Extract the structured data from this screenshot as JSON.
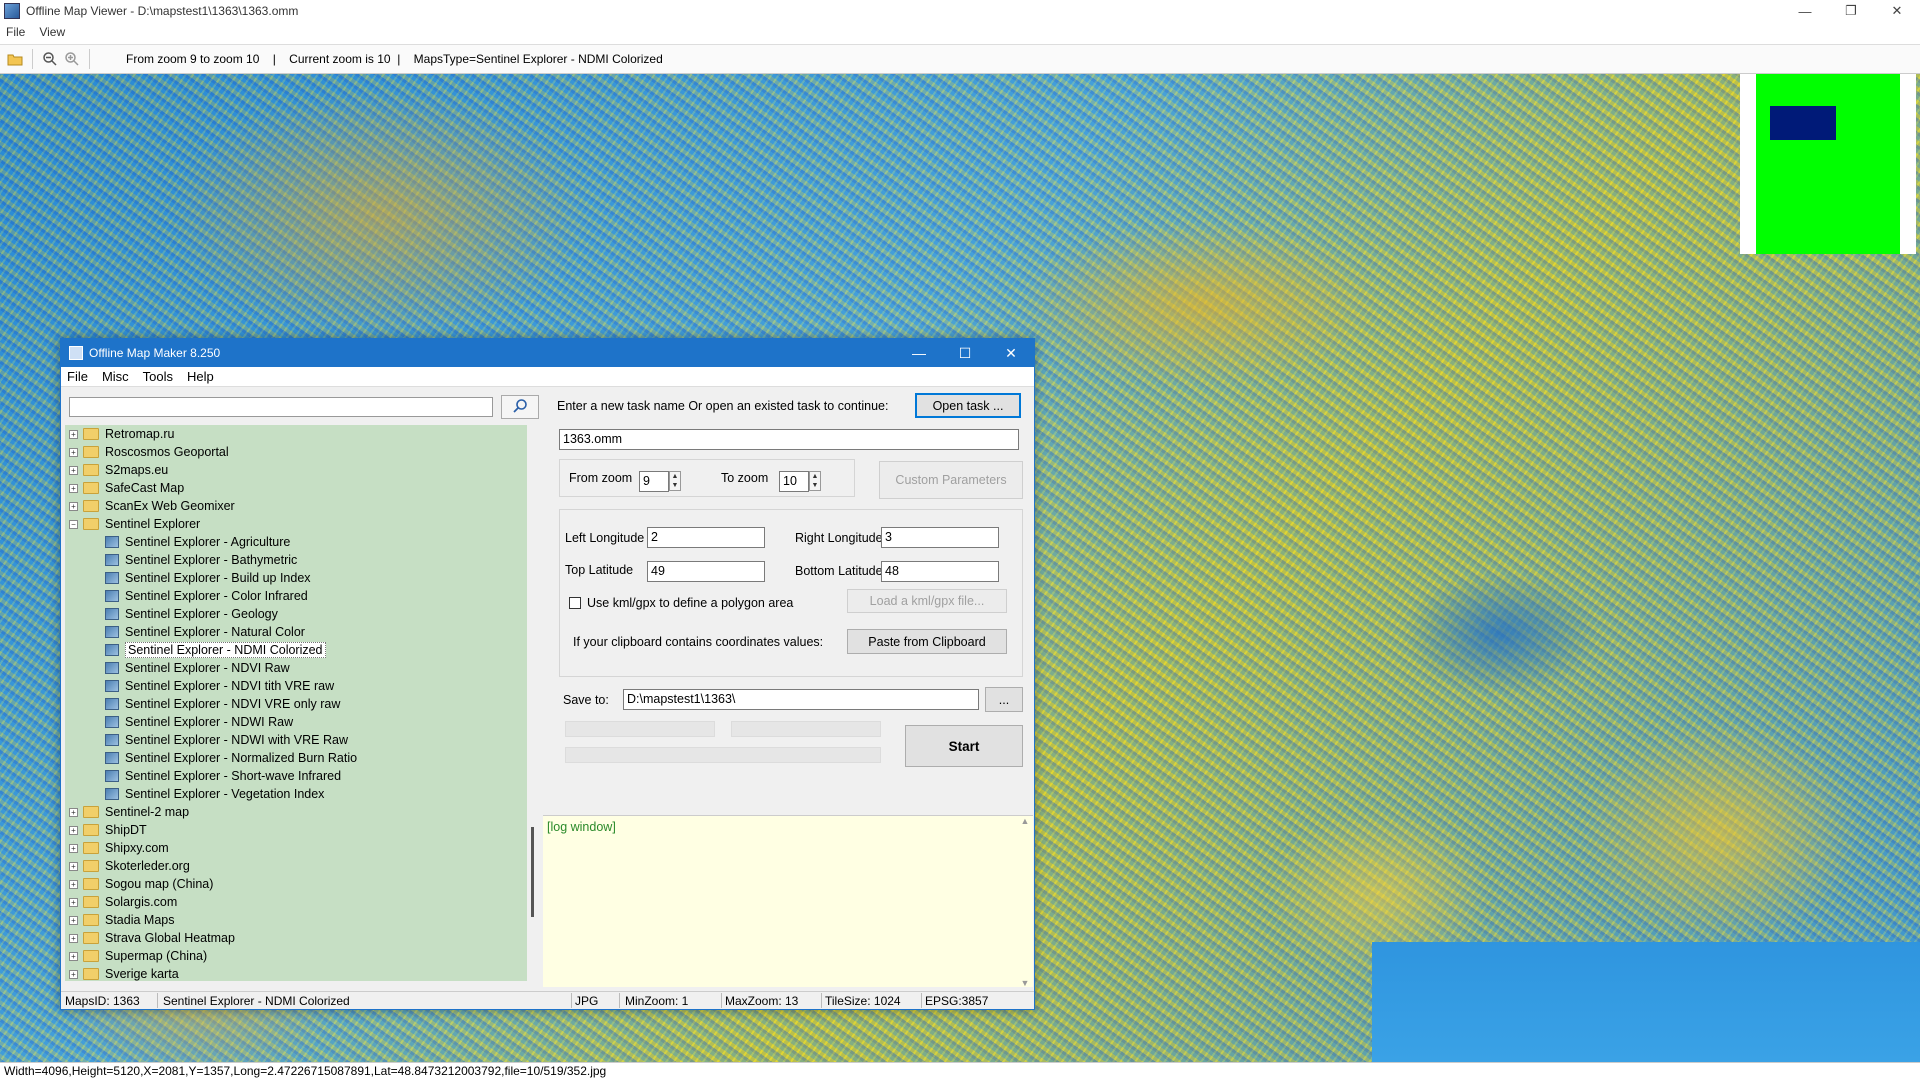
{
  "window": {
    "title": "Offline Map Viewer - D:\\mapstest1\\1363\\1363.omm",
    "controls": [
      "—",
      "❐",
      "✕"
    ]
  },
  "menu": [
    "File",
    "View"
  ],
  "toolbar": {
    "icons": [
      "folder-open-icon",
      "zoom-out-icon",
      "zoom-in-icon"
    ],
    "info": "From zoom 9 to zoom 10    |    Current zoom is 10  |    MapsType=Sentinel Explorer - NDMI Colorized"
  },
  "colors": {
    "minimap_area": "#00ff00",
    "minimap_view": "#001a78",
    "dialog_title": "#1e73c9",
    "tree_bg": "#c6dfc4",
    "log_bg": "#ffffe3"
  },
  "status": "Width=4096,Height=5120,X=2081,Y=1357,Long=2.47226715087891,Lat=48.8473212003792,file=10/519/352.jpg",
  "dialog": {
    "title": "Offline Map Maker 8.250",
    "controls": [
      "—",
      "☐",
      "✕"
    ],
    "menu": [
      "File",
      "Misc",
      "Tools",
      "Help"
    ],
    "search": {
      "value": "",
      "placeholder": ""
    },
    "tree": [
      {
        "label": "Retromap.ru",
        "type": "folder",
        "expanded": false
      },
      {
        "label": "Roscosmos Geoportal",
        "type": "folder",
        "expanded": false
      },
      {
        "label": "S2maps.eu",
        "type": "folder",
        "expanded": false
      },
      {
        "label": "SafeCast Map",
        "type": "folder",
        "expanded": false
      },
      {
        "label": "ScanEx Web Geomixer",
        "type": "folder",
        "expanded": false
      },
      {
        "label": "Sentinel Explorer",
        "type": "folder",
        "expanded": true
      },
      {
        "label": "Sentinel Explorer - Agriculture",
        "type": "map"
      },
      {
        "label": "Sentinel Explorer - Bathymetric",
        "type": "map"
      },
      {
        "label": "Sentinel Explorer - Build up Index",
        "type": "map"
      },
      {
        "label": "Sentinel Explorer - Color Infrared",
        "type": "map"
      },
      {
        "label": "Sentinel Explorer - Geology",
        "type": "map"
      },
      {
        "label": "Sentinel Explorer - Natural Color",
        "type": "map"
      },
      {
        "label": "Sentinel Explorer - NDMI Colorized",
        "type": "map",
        "selected": true
      },
      {
        "label": "Sentinel Explorer - NDVI Raw",
        "type": "map"
      },
      {
        "label": "Sentinel Explorer - NDVI tith VRE raw",
        "type": "map"
      },
      {
        "label": "Sentinel Explorer - NDVI VRE only raw",
        "type": "map"
      },
      {
        "label": "Sentinel Explorer - NDWI Raw",
        "type": "map"
      },
      {
        "label": "Sentinel Explorer - NDWI with VRE Raw",
        "type": "map"
      },
      {
        "label": "Sentinel Explorer - Normalized Burn Ratio",
        "type": "map"
      },
      {
        "label": "Sentinel Explorer - Short-wave Infrared",
        "type": "map"
      },
      {
        "label": "Sentinel Explorer - Vegetation Index",
        "type": "map"
      },
      {
        "label": "Sentinel-2 map",
        "type": "folder",
        "expanded": false
      },
      {
        "label": "ShipDT",
        "type": "folder",
        "expanded": false
      },
      {
        "label": "Shipxy.com",
        "type": "folder",
        "expanded": false
      },
      {
        "label": "Skoterleder.org",
        "type": "folder",
        "expanded": false
      },
      {
        "label": "Sogou map (China)",
        "type": "folder",
        "expanded": false
      },
      {
        "label": "Solargis.com",
        "type": "folder",
        "expanded": false
      },
      {
        "label": "Stadia Maps",
        "type": "folder",
        "expanded": false
      },
      {
        "label": "Strava Global Heatmap",
        "type": "folder",
        "expanded": false
      },
      {
        "label": "Supermap (China)",
        "type": "folder",
        "expanded": false
      },
      {
        "label": "Sverige karta",
        "type": "folder",
        "expanded": false
      }
    ],
    "task_prompt": "Enter a new task name Or open an existed task to continue:",
    "open_task_label": "Open task ...",
    "task_name": "1363.omm",
    "from_zoom_label": "From zoom",
    "from_zoom": "9",
    "to_zoom_label": "To zoom",
    "to_zoom": "10",
    "custom_params_label": "Custom Parameters",
    "left_lon_label": "Left Longitude",
    "left_lon": "2",
    "right_lon_label": "Right Longitude",
    "right_lon": "3",
    "top_lat_label": "Top Latitude",
    "top_lat": "49",
    "bottom_lat_label": "Bottom Latitude",
    "bottom_lat": "48",
    "kml_checkbox_label": "Use kml/gpx to define a polygon area",
    "load_kml_label": "Load a kml/gpx file...",
    "clipboard_prompt": "If your clipboard contains coordinates values:",
    "paste_label": "Paste from Clipboard",
    "save_to_label": "Save to:",
    "save_to": "D:\\mapstest1\\1363\\",
    "browse_label": "...",
    "start_label": "Start",
    "log_text": "[log window]",
    "status": {
      "maps_id": "MapsID: 1363",
      "map_name": "Sentinel Explorer - NDMI Colorized",
      "format": "JPG",
      "min_zoom": "MinZoom: 1",
      "max_zoom": "MaxZoom: 13",
      "tile_size": "TileSize: 1024",
      "epsg": "EPSG:3857"
    }
  }
}
